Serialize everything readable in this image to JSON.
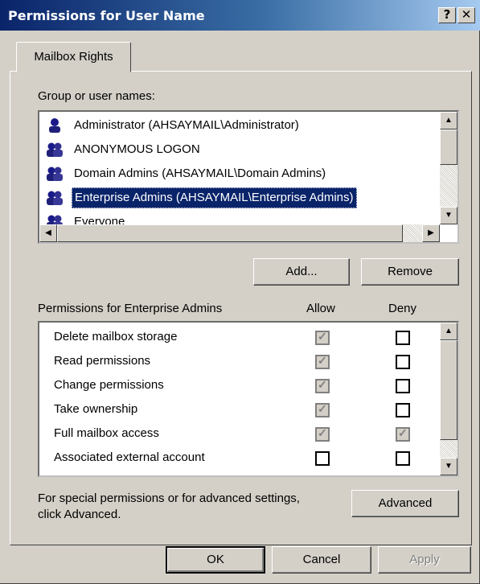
{
  "window": {
    "title": "Permissions for User Name",
    "help_btn": "?",
    "close_btn": "✕"
  },
  "tab": {
    "label": "Mailbox Rights"
  },
  "users_section": {
    "label": "Group or user names:",
    "users": [
      {
        "name": "Administrator (AHSAYMAIL\\Administrator)",
        "icon": "user-icon",
        "selected": false
      },
      {
        "name": "ANONYMOUS LOGON",
        "icon": "group-icon",
        "selected": false
      },
      {
        "name": "Domain Admins (AHSAYMAIL\\Domain Admins)",
        "icon": "group-icon",
        "selected": false
      },
      {
        "name": "Enterprise Admins (AHSAYMAIL\\Enterprise Admins)",
        "icon": "group-icon",
        "selected": true
      },
      {
        "name": "Everyone",
        "icon": "group-icon",
        "selected": false
      }
    ],
    "add_button": "Add...",
    "remove_button": "Remove"
  },
  "permissions_section": {
    "label": "Permissions for Enterprise Admins",
    "allow_header": "Allow",
    "deny_header": "Deny",
    "permissions": [
      {
        "name": "Delete mailbox storage",
        "allow": "checked-disabled",
        "deny": "unchecked"
      },
      {
        "name": "Read permissions",
        "allow": "checked-disabled",
        "deny": "unchecked"
      },
      {
        "name": "Change permissions",
        "allow": "checked-disabled",
        "deny": "unchecked"
      },
      {
        "name": "Take ownership",
        "allow": "checked-disabled",
        "deny": "unchecked"
      },
      {
        "name": "Full mailbox access",
        "allow": "checked-disabled",
        "deny": "checked-disabled"
      },
      {
        "name": "Associated external account",
        "allow": "unchecked",
        "deny": "unchecked"
      }
    ]
  },
  "advanced_section": {
    "text_line1": "For special permissions or for advanced settings,",
    "text_line2": "click Advanced.",
    "advanced_button": "Advanced"
  },
  "footer": {
    "ok_button": "OK",
    "cancel_button": "Cancel",
    "apply_button": "Apply"
  },
  "colors": {
    "titlebar_start": "#0a246a",
    "titlebar_end": "#a6caf0",
    "selection": "#0a246a",
    "dialog_bg": "#d4d0c8"
  }
}
